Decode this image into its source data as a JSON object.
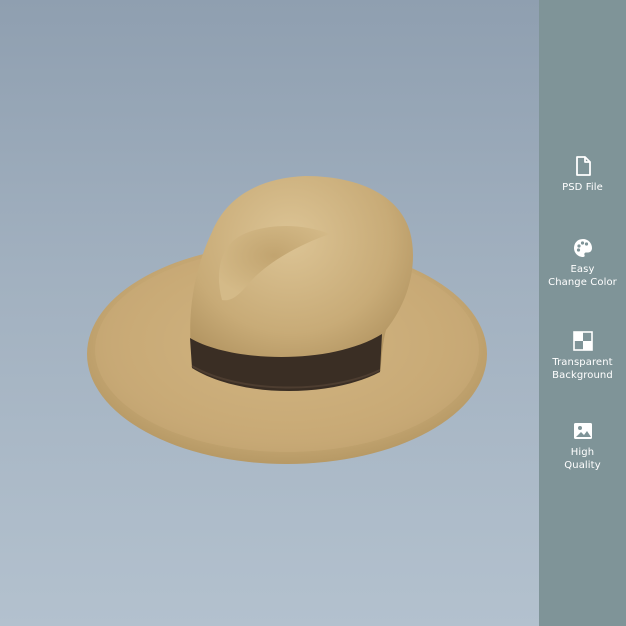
{
  "product": {
    "image_name": "hat-3d-render",
    "colors": {
      "background_top": "#8f9fb0",
      "background_bottom": "#b3c1ce",
      "hat": "#c8ab77",
      "band": "#3a2e24",
      "sidebar": "#7f9498"
    }
  },
  "features": [
    {
      "icon": "file-icon",
      "label": "PSD File"
    },
    {
      "icon": "palette-icon",
      "label": "Easy\nChange Color"
    },
    {
      "icon": "transparent-grid-icon",
      "label": "Transparent\nBackground"
    },
    {
      "icon": "image-icon",
      "label": "High\nQuality"
    }
  ]
}
